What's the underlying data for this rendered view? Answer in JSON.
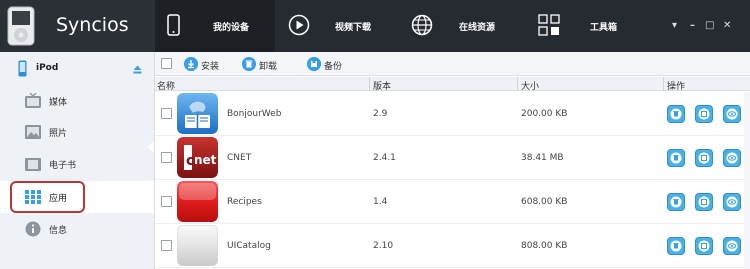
{
  "app": {
    "title": "Syncios"
  },
  "nav": {
    "tabs": [
      {
        "label": "我的设备",
        "icon": "phone-icon"
      },
      {
        "label": "视频下载",
        "icon": "play-icon"
      },
      {
        "label": "在线资源",
        "icon": "globe-icon"
      },
      {
        "label": "工具箱",
        "icon": "grid-icon"
      }
    ],
    "window_controls": [
      "▾",
      "–",
      "□",
      "✕"
    ]
  },
  "sidebar": {
    "device": "iPod",
    "items": [
      {
        "label": "媒体",
        "icon": "tv-icon"
      },
      {
        "label": "照片",
        "icon": "photo-icon"
      },
      {
        "label": "电子书",
        "icon": "book-icon"
      },
      {
        "label": "应用",
        "icon": "apps-icon",
        "active": true
      },
      {
        "label": "信息",
        "icon": "info-icon"
      }
    ]
  },
  "toolbar": {
    "install": "安装",
    "uninstall": "卸载",
    "backup": "备份"
  },
  "table": {
    "columns": [
      "名称",
      "版本",
      "大小",
      "操作"
    ],
    "rows": [
      {
        "name": "BonjourWeb",
        "version": "2.9",
        "size": "200.00 KB"
      },
      {
        "name": "CNET",
        "version": "2.4.1",
        "size": "38.41 MB"
      },
      {
        "name": "Recipes",
        "version": "1.4",
        "size": "608.00 KB"
      },
      {
        "name": "UICatalog",
        "version": "2.10",
        "size": "808.00 KB"
      }
    ]
  },
  "colors": {
    "accent": "#3a9ee6",
    "topbar": "#262a31",
    "highlight": "#b43a3a"
  }
}
